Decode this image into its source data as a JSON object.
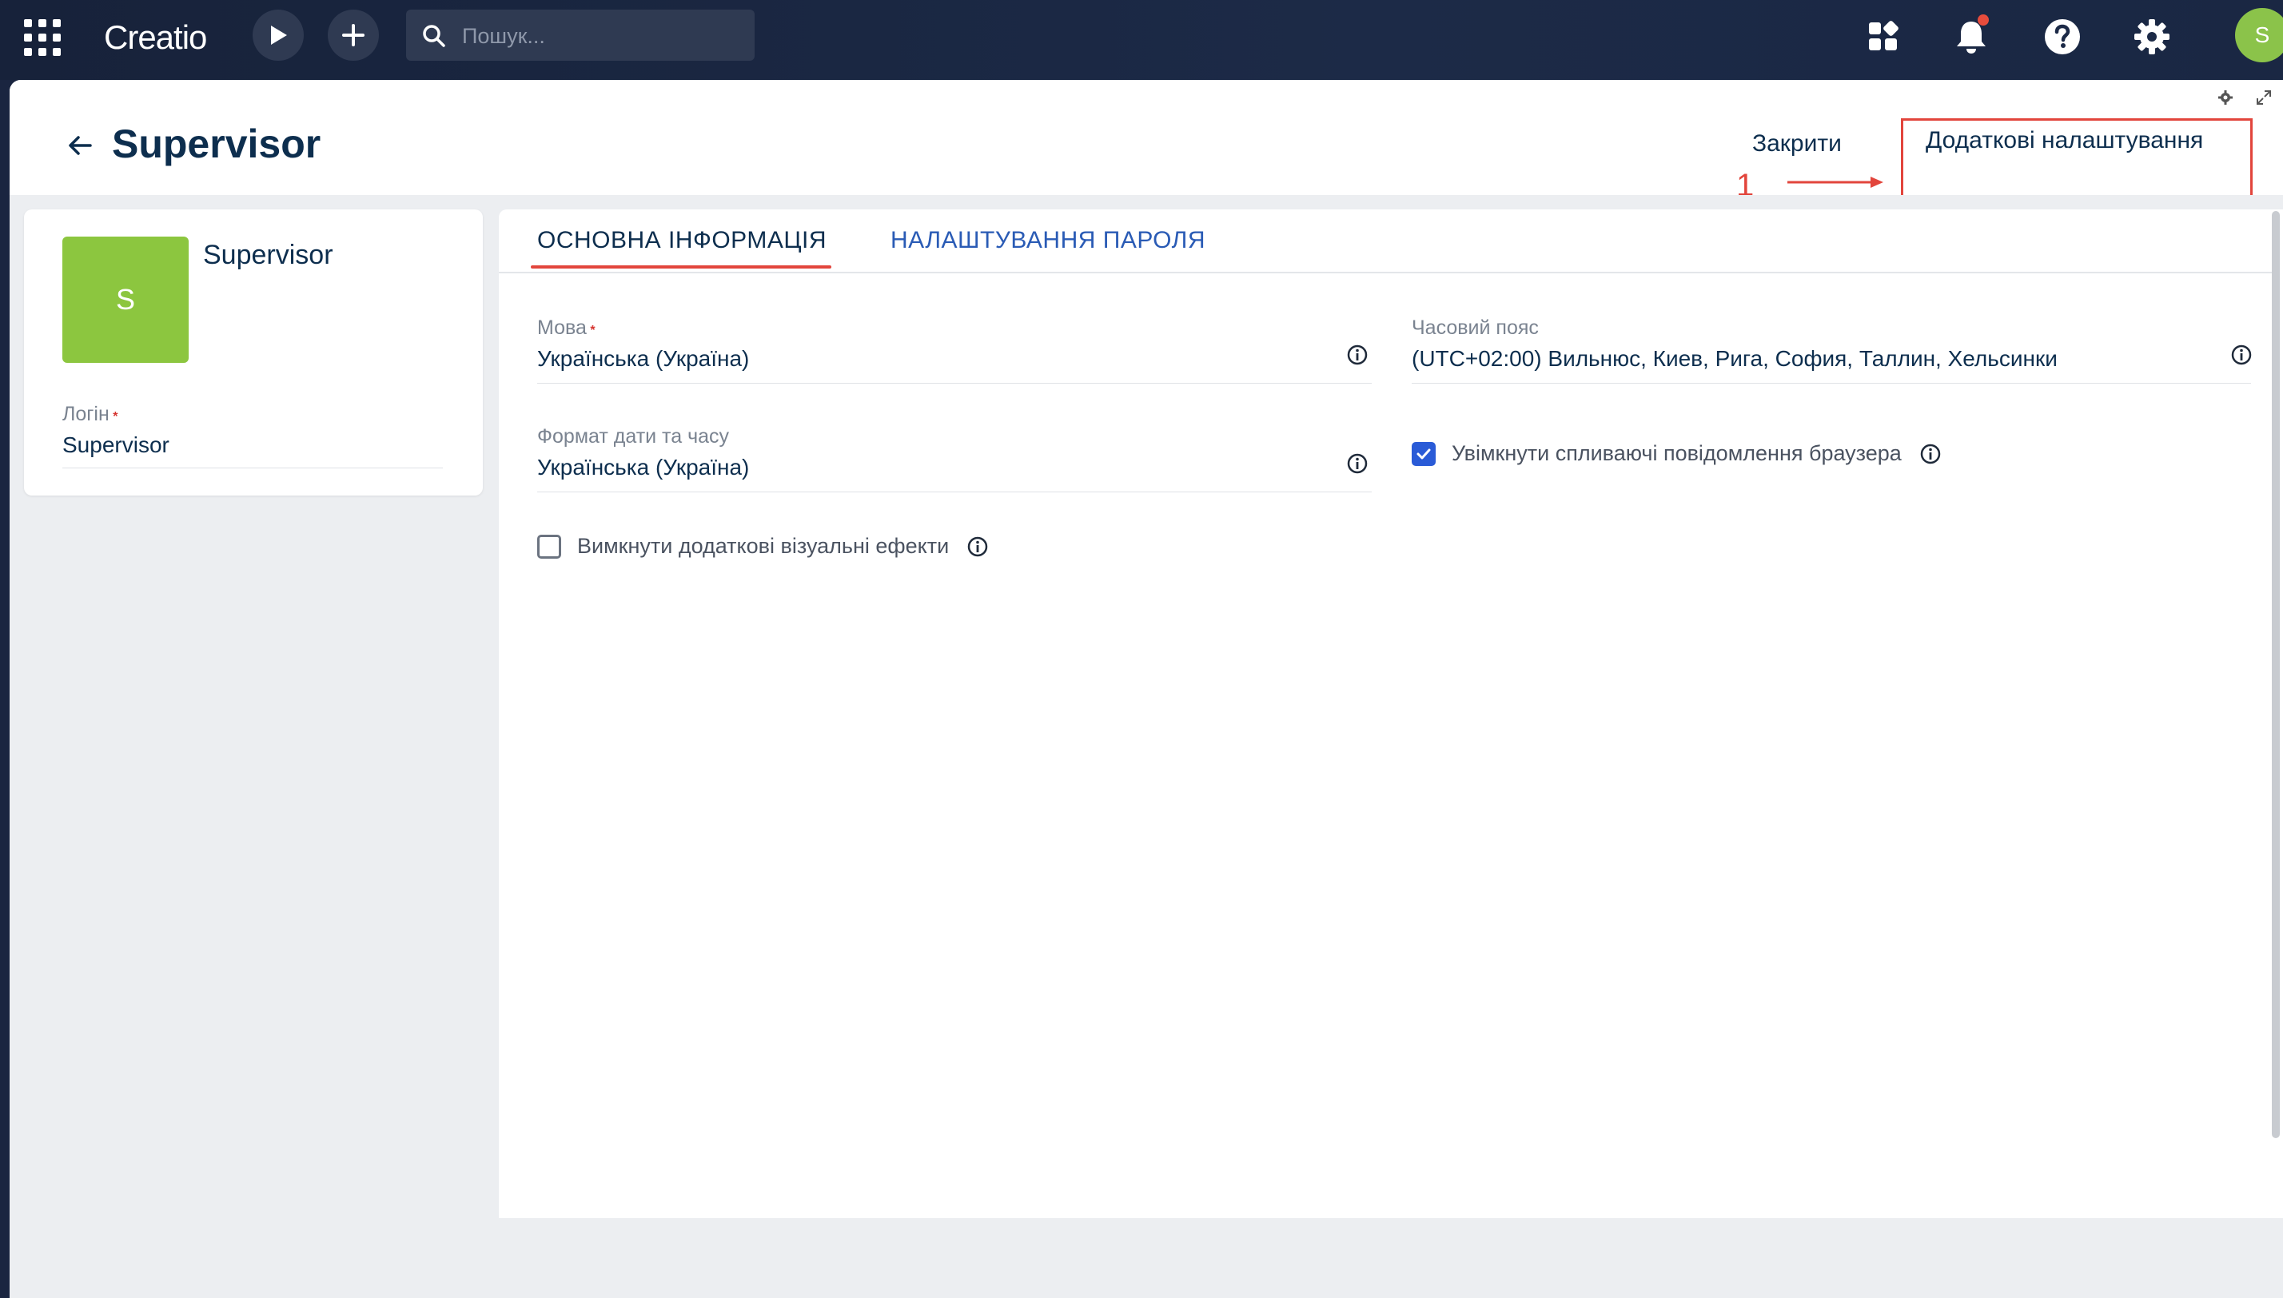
{
  "topbar": {
    "logo": "Creatio",
    "search_placeholder": "Пошук...",
    "avatar_initial": "S"
  },
  "header": {
    "title": "Supervisor",
    "close_label": "Закрити",
    "extra_settings_label": "Додаткові налаштування",
    "annotation_number": "1"
  },
  "profile": {
    "avatar_initial": "S",
    "name": "Supervisor",
    "login_label": "Логін",
    "login_required": "*",
    "login_value": "Supervisor"
  },
  "tabs": [
    {
      "label": "ОСНОВНА ІНФОРМАЦІЯ",
      "active": true
    },
    {
      "label": "НАЛАШТУВАННЯ ПАРОЛЯ",
      "active": false
    }
  ],
  "fields": {
    "language": {
      "label": "Мова",
      "required": "*",
      "value": "Українська (Україна)"
    },
    "timezone": {
      "label": "Часовий пояс",
      "value": "(UTC+02:00) Вильнюс, Киев, Рига, София, Таллин, Хельсинки"
    },
    "datetime_format": {
      "label": "Формат дати та часу",
      "value": "Українська (Україна)"
    },
    "browser_notifications": {
      "label": "Увімкнути спливаючі повідомлення браузера",
      "checked": true
    },
    "disable_visual_effects": {
      "label": "Вимкнути додаткові візуальні ефекти",
      "checked": false
    }
  },
  "colors": {
    "accent_red": "#e2453c",
    "title_navy": "#0d2e4e",
    "link_blue": "#2a5bb5",
    "avatar_green": "#8cc63f"
  }
}
